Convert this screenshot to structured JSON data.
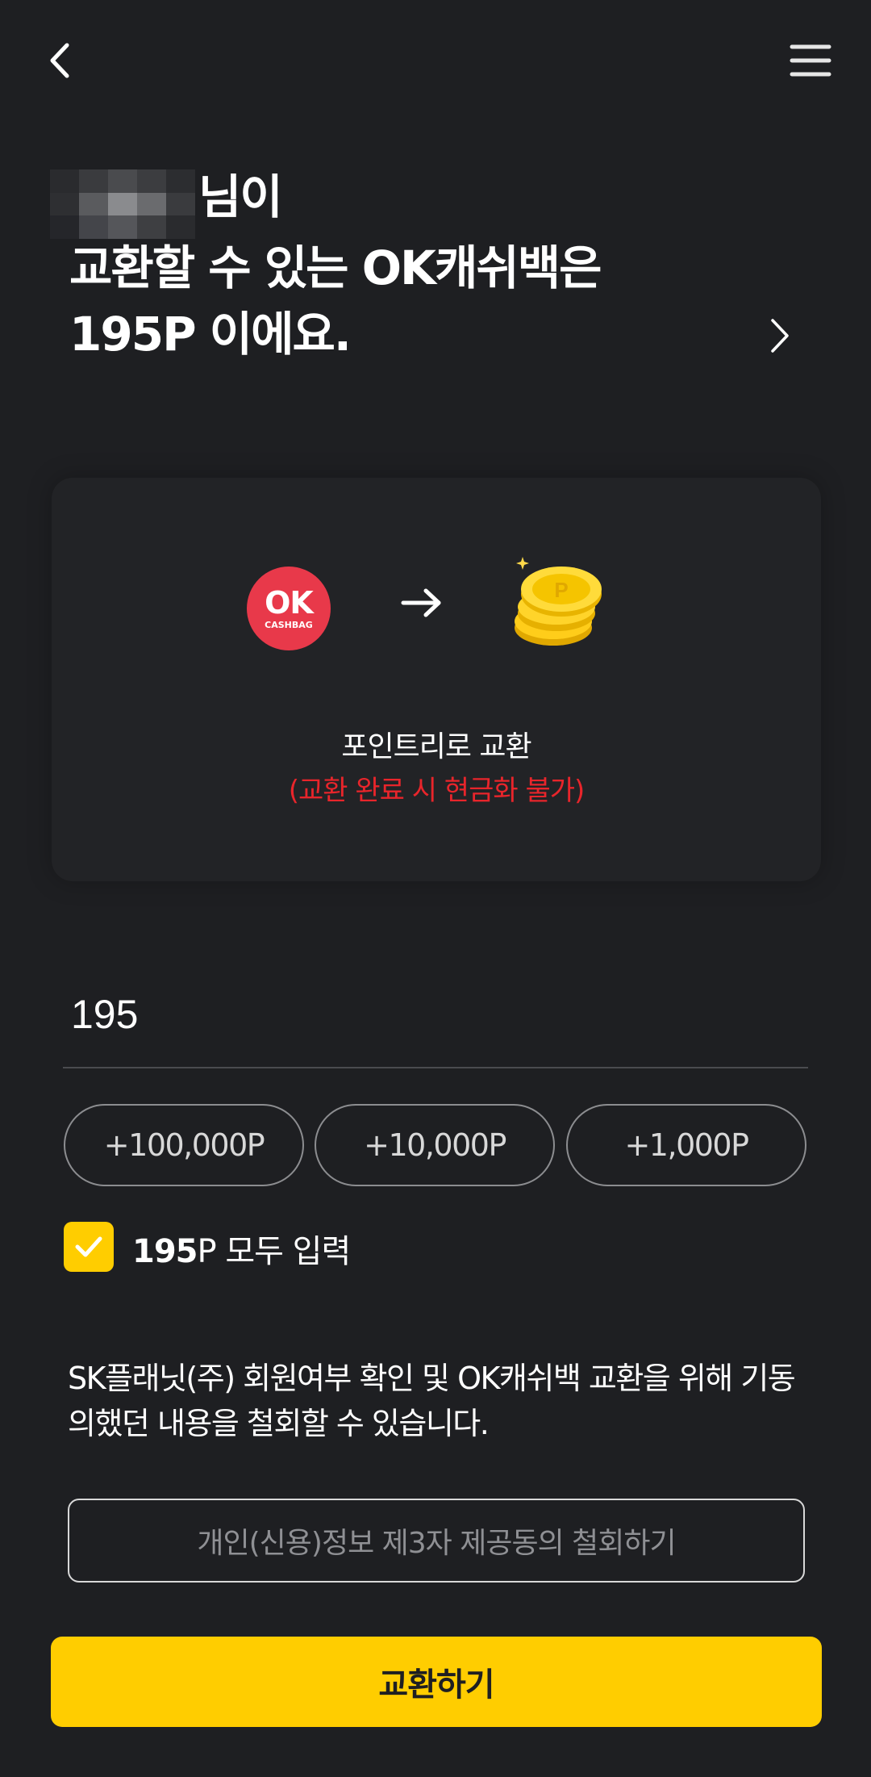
{
  "header": {
    "back_icon": "chevron-left-icon",
    "menu_icon": "hamburger-menu-icon"
  },
  "title": {
    "line1_suffix": "님이",
    "line2": "교환할 수 있는 OK캐쉬백은",
    "line3": "195P 이에요."
  },
  "card": {
    "ok_logo_text": "OK",
    "ok_logo_sub": "CASHBAG",
    "label": "포인트리로 교환",
    "warning": "(교환 완료 시 현금화 불가)"
  },
  "amount": {
    "value": "195"
  },
  "chips": [
    "+100,000P",
    "+10,000P",
    "+1,000P"
  ],
  "use_all": {
    "checked": true,
    "points": "195",
    "label": "P 모두 입력"
  },
  "notice": "SK플래닛(주) 회원여부 확인 및 OK캐쉬백 교환을 위해 기동의했던 내용을 철회할 수 있습니다.",
  "withdraw_button": "개인(신용)정보 제3자 제공동의 철회하기",
  "submit_button": "교환하기",
  "colors": {
    "background": "#1e1f22",
    "accent": "#ffcd00",
    "warning": "#e8252b",
    "ok_red": "#e8394a"
  }
}
